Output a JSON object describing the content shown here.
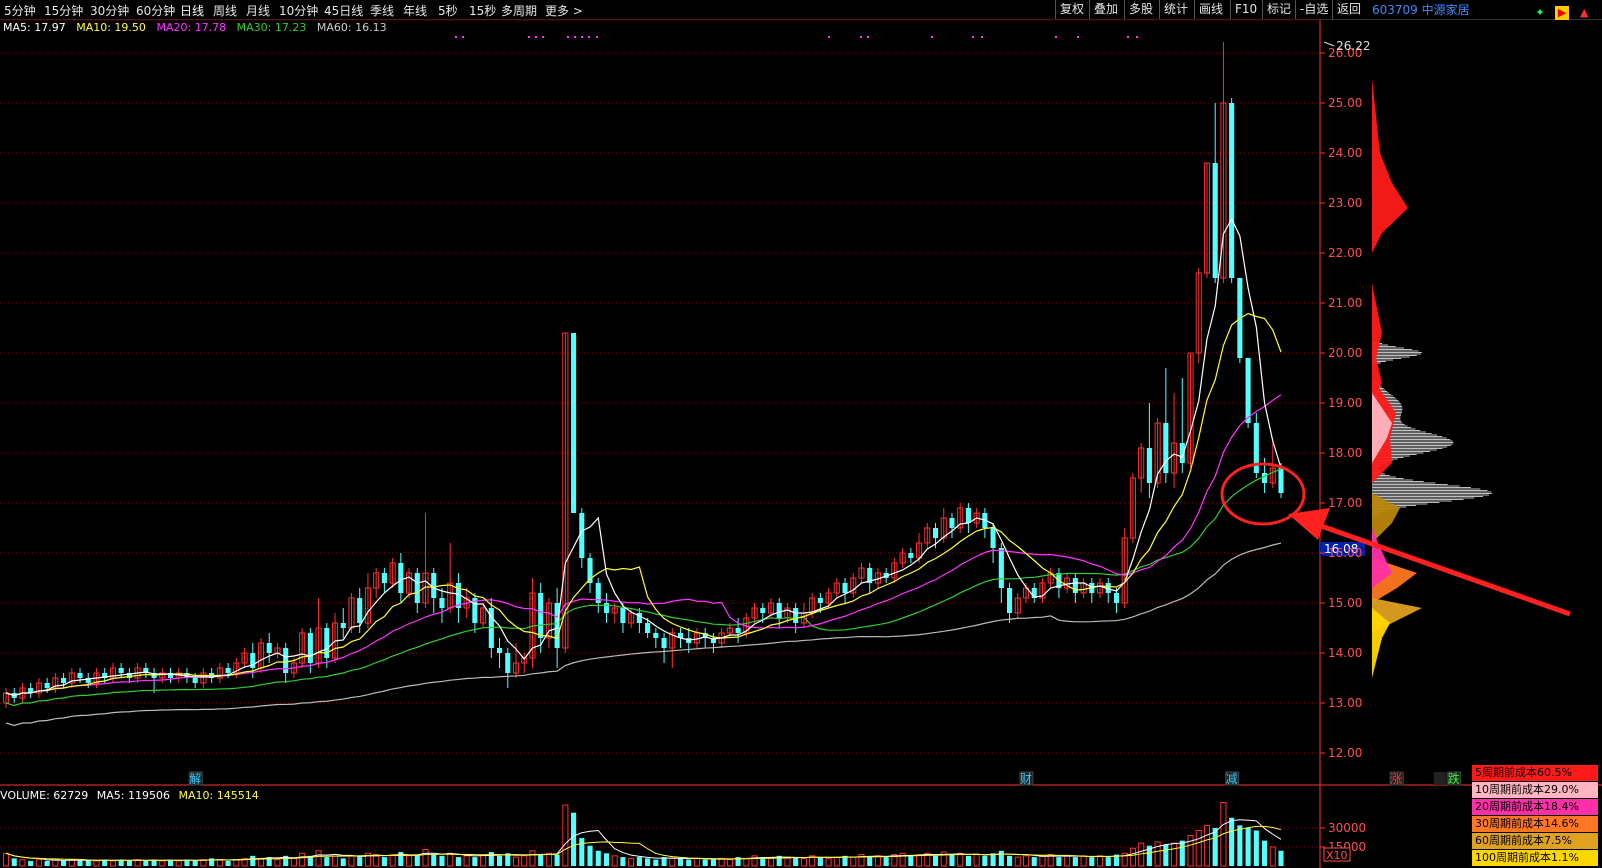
{
  "toolbar": {
    "tabs": [
      "5分钟",
      "15分钟",
      "30分钟",
      "60分钟",
      "日线",
      "周线",
      "月线",
      "10分钟",
      "45日线",
      "季线",
      "年线",
      "5秒",
      "15秒",
      "多周期",
      "更多 >"
    ],
    "active_tab": "日线",
    "right_buttons": [
      "复权",
      "叠加",
      "多股",
      "统计",
      "画线",
      "F10",
      "标记",
      "-自选",
      "返回"
    ],
    "stock": "603709 中源家居"
  },
  "ma_legend": {
    "ma5": "MA5: 17.97",
    "ma10": "MA10: 19.50",
    "ma20": "MA20: 17.78",
    "ma30": "MA30: 17.23",
    "ma60": "MA60: 16.13"
  },
  "volume_legend": {
    "volume": "VOLUME: 62729",
    "ma5": "MA5: 119506",
    "ma10": "MA10: 145514"
  },
  "cost_boxes": [
    {
      "label": "5周期前成本60.5%",
      "color": "#ff1a1a"
    },
    {
      "label": "10周期前成本29.0%",
      "color": "#ffb6c1"
    },
    {
      "label": "20周期前成本18.4%",
      "color": "#ff2fa8"
    },
    {
      "label": "30周期前成本14.6%",
      "color": "#ff7722"
    },
    {
      "label": "60周期前成本7.5%",
      "color": "#e0a020"
    },
    {
      "label": "100周期前成本1.1%",
      "color": "#ffd700"
    }
  ],
  "colors": {
    "up": "#ff3030",
    "down": "#54ffff",
    "ma5": "#ffffff",
    "ma10": "#ffff33",
    "ma20": "#ff33ff",
    "ma30": "#33cc33",
    "ma60": "#bbbbbb",
    "grid": "#8b0000",
    "axis": "#ff3030"
  },
  "chart_data": {
    "type": "candlestick",
    "price_ticks": [
      "26.00",
      "25.00",
      "24.00",
      "23.00",
      "22.00",
      "21.00",
      "20.00",
      "19.00",
      "18.00",
      "17.00",
      "16.00",
      "15.00",
      "14.00",
      "13.00",
      "12.00"
    ],
    "ylim": [
      11.8,
      26.6
    ],
    "high_label": "26.22",
    "current_price_label": "16.08",
    "volume_ticks": [
      "30000",
      "15000"
    ],
    "volume_unit": "X10",
    "event_markers": [
      {
        "label": "解",
        "index": 23
      },
      {
        "label": "财",
        "index": 124
      },
      {
        "label": "减",
        "index": 149
      },
      {
        "label": "涨",
        "index": 169
      },
      {
        "label": "跌",
        "index": 176
      }
    ],
    "candles": [
      [
        13.0,
        13.2,
        12.9,
        13.3
      ],
      [
        13.2,
        13.1,
        13.0,
        13.3
      ],
      [
        13.1,
        13.3,
        13.0,
        13.4
      ],
      [
        13.3,
        13.2,
        13.1,
        13.4
      ],
      [
        13.2,
        13.4,
        13.1,
        13.5
      ],
      [
        13.4,
        13.3,
        13.2,
        13.5
      ],
      [
        13.3,
        13.5,
        13.2,
        13.6
      ],
      [
        13.5,
        13.4,
        13.3,
        13.6
      ],
      [
        13.4,
        13.6,
        13.3,
        13.7
      ],
      [
        13.6,
        13.5,
        13.4,
        13.7
      ],
      [
        13.5,
        13.4,
        13.3,
        13.6
      ],
      [
        13.4,
        13.6,
        13.3,
        13.7
      ],
      [
        13.6,
        13.5,
        13.4,
        13.7
      ],
      [
        13.5,
        13.7,
        13.4,
        13.8
      ],
      [
        13.7,
        13.6,
        13.5,
        13.8
      ],
      [
        13.6,
        13.5,
        13.4,
        13.7
      ],
      [
        13.5,
        13.7,
        13.4,
        13.8
      ],
      [
        13.7,
        13.6,
        13.5,
        13.8
      ],
      [
        13.6,
        13.5,
        13.2,
        13.7
      ],
      [
        13.5,
        13.6,
        13.4,
        13.7
      ],
      [
        13.6,
        13.5,
        13.4,
        13.7
      ],
      [
        13.5,
        13.6,
        13.4,
        13.7
      ],
      [
        13.6,
        13.5,
        13.4,
        13.7
      ],
      [
        13.5,
        13.4,
        13.3,
        13.6
      ],
      [
        13.4,
        13.6,
        13.3,
        13.7
      ],
      [
        13.6,
        13.5,
        13.4,
        13.7
      ],
      [
        13.5,
        13.7,
        13.4,
        13.8
      ],
      [
        13.7,
        13.6,
        13.5,
        13.8
      ],
      [
        13.6,
        13.8,
        13.5,
        13.9
      ],
      [
        13.8,
        14.0,
        13.7,
        14.1
      ],
      [
        14.0,
        13.7,
        13.5,
        14.2
      ],
      [
        13.7,
        14.2,
        13.6,
        14.3
      ],
      [
        14.2,
        14.0,
        13.8,
        14.4
      ],
      [
        14.0,
        14.1,
        13.9,
        14.2
      ],
      [
        14.1,
        13.6,
        13.4,
        14.2
      ],
      [
        13.6,
        13.8,
        13.5,
        13.9
      ],
      [
        13.8,
        14.4,
        13.7,
        14.5
      ],
      [
        14.4,
        13.8,
        13.6,
        14.5
      ],
      [
        13.8,
        14.5,
        13.7,
        15.1
      ],
      [
        14.5,
        13.9,
        13.7,
        14.6
      ],
      [
        13.9,
        14.6,
        13.8,
        14.8
      ],
      [
        14.6,
        14.5,
        14.3,
        14.9
      ],
      [
        14.5,
        15.1,
        14.4,
        15.2
      ],
      [
        15.1,
        14.6,
        14.4,
        15.3
      ],
      [
        14.6,
        15.3,
        14.5,
        15.6
      ],
      [
        15.3,
        15.6,
        15.1,
        15.7
      ],
      [
        15.6,
        15.4,
        15.2,
        15.7
      ],
      [
        15.4,
        15.8,
        15.3,
        15.9
      ],
      [
        15.8,
        15.2,
        15.0,
        16.0
      ],
      [
        15.2,
        15.6,
        15.1,
        15.7
      ],
      [
        15.6,
        15.0,
        14.8,
        15.7
      ],
      [
        15.0,
        15.6,
        14.9,
        16.8
      ],
      [
        15.6,
        15.1,
        14.8,
        15.7
      ],
      [
        15.1,
        14.9,
        14.6,
        15.3
      ],
      [
        14.9,
        15.4,
        14.8,
        16.2
      ],
      [
        15.4,
        14.9,
        14.6,
        15.6
      ],
      [
        14.9,
        15.1,
        14.7,
        15.3
      ],
      [
        15.1,
        14.6,
        14.4,
        15.2
      ],
      [
        14.6,
        14.9,
        14.5,
        15.0
      ],
      [
        14.9,
        14.1,
        13.9,
        15.1
      ],
      [
        14.1,
        14.0,
        13.7,
        14.3
      ],
      [
        14.0,
        13.6,
        13.3,
        14.1
      ],
      [
        13.6,
        13.8,
        13.5,
        14.2
      ],
      [
        13.8,
        13.9,
        13.6,
        14.0
      ],
      [
        13.9,
        15.2,
        13.7,
        15.5
      ],
      [
        15.2,
        14.3,
        14.0,
        15.4
      ],
      [
        14.3,
        15.0,
        14.1,
        15.1
      ],
      [
        15.0,
        14.1,
        13.7,
        15.3
      ],
      [
        14.1,
        20.4,
        14.0,
        20.4
      ],
      [
        20.4,
        16.8,
        16.8,
        20.4
      ],
      [
        16.8,
        15.9,
        15.7,
        16.9
      ],
      [
        15.9,
        15.4,
        15.2,
        16.0
      ],
      [
        15.4,
        15.0,
        14.8,
        15.5
      ],
      [
        15.0,
        14.8,
        14.6,
        15.2
      ],
      [
        14.8,
        14.9,
        14.6,
        15.0
      ],
      [
        14.9,
        14.6,
        14.4,
        15.0
      ],
      [
        14.6,
        14.8,
        14.5,
        14.9
      ],
      [
        14.8,
        14.6,
        14.4,
        14.9
      ],
      [
        14.6,
        14.4,
        14.3,
        14.7
      ],
      [
        14.4,
        14.3,
        14.1,
        14.5
      ],
      [
        14.3,
        14.1,
        13.8,
        14.4
      ],
      [
        14.1,
        14.4,
        13.7,
        14.5
      ],
      [
        14.4,
        14.3,
        14.1,
        14.5
      ],
      [
        14.3,
        14.2,
        14.0,
        14.5
      ],
      [
        14.2,
        14.4,
        14.1,
        14.5
      ],
      [
        14.4,
        14.3,
        14.1,
        14.5
      ],
      [
        14.3,
        14.2,
        14.0,
        14.4
      ],
      [
        14.2,
        14.4,
        14.1,
        14.5
      ],
      [
        14.4,
        14.5,
        14.3,
        14.6
      ],
      [
        14.5,
        14.4,
        14.2,
        14.7
      ],
      [
        14.4,
        14.7,
        14.3,
        14.8
      ],
      [
        14.7,
        14.9,
        14.6,
        15.0
      ],
      [
        14.9,
        14.8,
        14.6,
        15.0
      ],
      [
        14.8,
        15.0,
        14.7,
        15.1
      ],
      [
        15.0,
        14.7,
        14.5,
        15.1
      ],
      [
        14.7,
        14.9,
        14.6,
        15.0
      ],
      [
        14.9,
        14.6,
        14.4,
        15.0
      ],
      [
        14.6,
        14.8,
        14.5,
        15.0
      ],
      [
        14.8,
        15.1,
        14.7,
        15.2
      ],
      [
        15.1,
        15.0,
        14.8,
        15.2
      ],
      [
        15.0,
        15.2,
        14.9,
        15.3
      ],
      [
        15.2,
        15.4,
        15.1,
        15.5
      ],
      [
        15.4,
        15.2,
        15.0,
        15.5
      ],
      [
        15.2,
        15.5,
        15.1,
        15.6
      ],
      [
        15.5,
        15.7,
        15.4,
        15.8
      ],
      [
        15.7,
        15.4,
        15.2,
        15.8
      ],
      [
        15.4,
        15.6,
        15.3,
        15.7
      ],
      [
        15.6,
        15.5,
        15.4,
        15.7
      ],
      [
        15.5,
        15.8,
        15.4,
        15.9
      ],
      [
        15.8,
        16.0,
        15.7,
        16.1
      ],
      [
        16.0,
        15.9,
        15.8,
        16.1
      ],
      [
        15.9,
        16.2,
        15.8,
        16.4
      ],
      [
        16.2,
        16.5,
        16.1,
        16.6
      ],
      [
        16.5,
        16.3,
        16.1,
        16.6
      ],
      [
        16.3,
        16.7,
        16.2,
        16.9
      ],
      [
        16.7,
        16.5,
        16.3,
        16.8
      ],
      [
        16.5,
        16.9,
        16.4,
        17.0
      ],
      [
        16.9,
        16.6,
        16.4,
        17.0
      ],
      [
        16.6,
        16.8,
        16.5,
        16.9
      ],
      [
        16.8,
        16.5,
        16.3,
        16.9
      ],
      [
        16.5,
        16.1,
        15.8,
        16.6
      ],
      [
        16.1,
        15.3,
        15.0,
        16.2
      ],
      [
        15.3,
        14.8,
        14.6,
        15.4
      ],
      [
        14.8,
        15.1,
        14.7,
        15.2
      ],
      [
        15.1,
        15.3,
        15.0,
        15.4
      ],
      [
        15.3,
        15.1,
        15.0,
        15.4
      ],
      [
        15.1,
        15.4,
        15.0,
        15.5
      ],
      [
        15.4,
        15.6,
        15.3,
        15.7
      ],
      [
        15.6,
        15.3,
        15.1,
        15.7
      ],
      [
        15.3,
        15.5,
        15.2,
        15.6
      ],
      [
        15.5,
        15.2,
        15.0,
        15.6
      ],
      [
        15.2,
        15.4,
        15.1,
        15.5
      ],
      [
        15.4,
        15.2,
        15.0,
        15.5
      ],
      [
        15.2,
        15.4,
        15.1,
        15.5
      ],
      [
        15.4,
        15.2,
        15.0,
        15.5
      ],
      [
        15.2,
        15.0,
        14.8,
        15.3
      ],
      [
        15.0,
        16.3,
        14.9,
        16.5
      ],
      [
        16.3,
        17.5,
        16.2,
        17.6
      ],
      [
        17.5,
        18.1,
        17.2,
        18.2
      ],
      [
        18.1,
        17.4,
        17.1,
        19.0
      ],
      [
        17.4,
        18.6,
        17.3,
        18.7
      ],
      [
        18.6,
        17.6,
        17.4,
        19.7
      ],
      [
        17.6,
        18.2,
        17.3,
        19.2
      ],
      [
        18.2,
        17.8,
        17.6,
        19.5
      ],
      [
        17.8,
        20.0,
        17.7,
        20.0
      ],
      [
        20.0,
        21.6,
        19.8,
        21.7
      ],
      [
        21.6,
        23.8,
        21.5,
        23.8
      ],
      [
        23.8,
        21.5,
        21.4,
        25.0
      ],
      [
        21.5,
        25.0,
        21.4,
        26.22
      ],
      [
        25.0,
        21.5,
        21.4,
        25.1
      ],
      [
        21.5,
        19.9,
        19.8,
        20.6
      ],
      [
        19.9,
        18.6,
        18.5,
        18.9
      ],
      [
        18.6,
        17.6,
        17.5,
        18.8
      ],
      [
        17.6,
        17.4,
        17.2,
        17.9
      ],
      [
        17.4,
        17.7,
        17.3,
        18.3
      ],
      [
        17.7,
        17.2,
        17.1,
        17.8
      ]
    ],
    "volumes": [
      10,
      6,
      5,
      4,
      5,
      4,
      5,
      4,
      5,
      4,
      5,
      4,
      5,
      4,
      5,
      4,
      5,
      4,
      5,
      4,
      5,
      4,
      5,
      4,
      5,
      6,
      5,
      4,
      5,
      6,
      8,
      6,
      7,
      5,
      8,
      6,
      10,
      8,
      12,
      7,
      9,
      6,
      8,
      7,
      10,
      9,
      7,
      9,
      11,
      8,
      9,
      13,
      9,
      8,
      10,
      7,
      8,
      7,
      9,
      11,
      8,
      10,
      7,
      8,
      12,
      9,
      10,
      9,
      48,
      42,
      22,
      16,
      12,
      10,
      8,
      7,
      6,
      7,
      6,
      5,
      7,
      6,
      6,
      5,
      6,
      5,
      5,
      6,
      5,
      7,
      6,
      8,
      7,
      6,
      8,
      6,
      7,
      6,
      8,
      7,
      6,
      7,
      8,
      7,
      9,
      7,
      8,
      7,
      9,
      10,
      8,
      9,
      10,
      8,
      11,
      9,
      10,
      8,
      9,
      8,
      10,
      12,
      8,
      7,
      8,
      7,
      8,
      9,
      7,
      8,
      7,
      8,
      7,
      8,
      7,
      9,
      10,
      14,
      18,
      16,
      19,
      17,
      18,
      20,
      24,
      28,
      32,
      30,
      50,
      38,
      32,
      30,
      28,
      20,
      15,
      12
    ],
    "ma60_end": 16.13
  }
}
